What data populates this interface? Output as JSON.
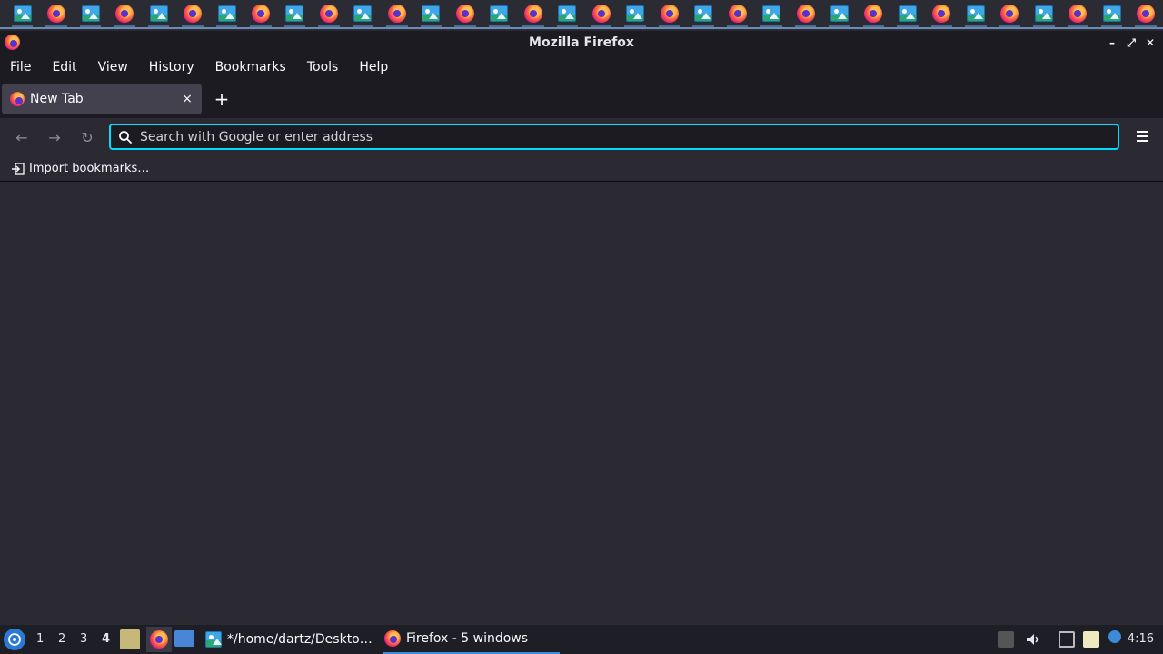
{
  "top_panel": {
    "icons": [
      "image-viewer-icon",
      "firefox-icon",
      "image-viewer-icon",
      "firefox-icon",
      "image-viewer-icon",
      "firefox-icon",
      "image-viewer-icon",
      "firefox-icon",
      "image-viewer-icon",
      "firefox-icon",
      "image-viewer-icon",
      "firefox-icon",
      "image-viewer-icon",
      "firefox-icon",
      "image-viewer-icon",
      "firefox-icon",
      "image-viewer-icon",
      "firefox-icon",
      "image-viewer-icon",
      "firefox-icon",
      "image-viewer-icon",
      "firefox-icon",
      "image-viewer-icon",
      "firefox-icon",
      "image-viewer-icon",
      "firefox-icon",
      "image-viewer-icon",
      "firefox-icon",
      "image-viewer-icon",
      "firefox-icon",
      "image-viewer-icon",
      "firefox-icon",
      "image-viewer-icon",
      "firefox-icon"
    ]
  },
  "window": {
    "title": "Mozilla Firefox",
    "controls": {
      "minimize": "–",
      "maximize": "⤢",
      "close": "✕"
    }
  },
  "menubar": {
    "items": [
      "File",
      "Edit",
      "View",
      "History",
      "Bookmarks",
      "Tools",
      "Help"
    ]
  },
  "tabs": [
    {
      "title": "New Tab",
      "close": "×"
    }
  ],
  "new_tab_symbol": "+",
  "urlbar": {
    "placeholder": "Search with Google or enter address",
    "value": ""
  },
  "nav": {
    "back": "←",
    "forward": "→",
    "reload": "↻"
  },
  "bookmarks_bar": {
    "import_label": "Import bookmarks…"
  },
  "taskbar": {
    "workspaces": [
      "1",
      "2",
      "3",
      "4"
    ],
    "active_workspace": "4",
    "tasks": [
      {
        "label": "*/home/dartz/Deskto…"
      },
      {
        "label": "Firefox - 5 windows"
      }
    ],
    "clock": "4:16"
  },
  "colors": {
    "accent_focus": "#00ddff",
    "toolbar_bg": "#2b2a33",
    "frame_bg": "#1c1b22"
  }
}
